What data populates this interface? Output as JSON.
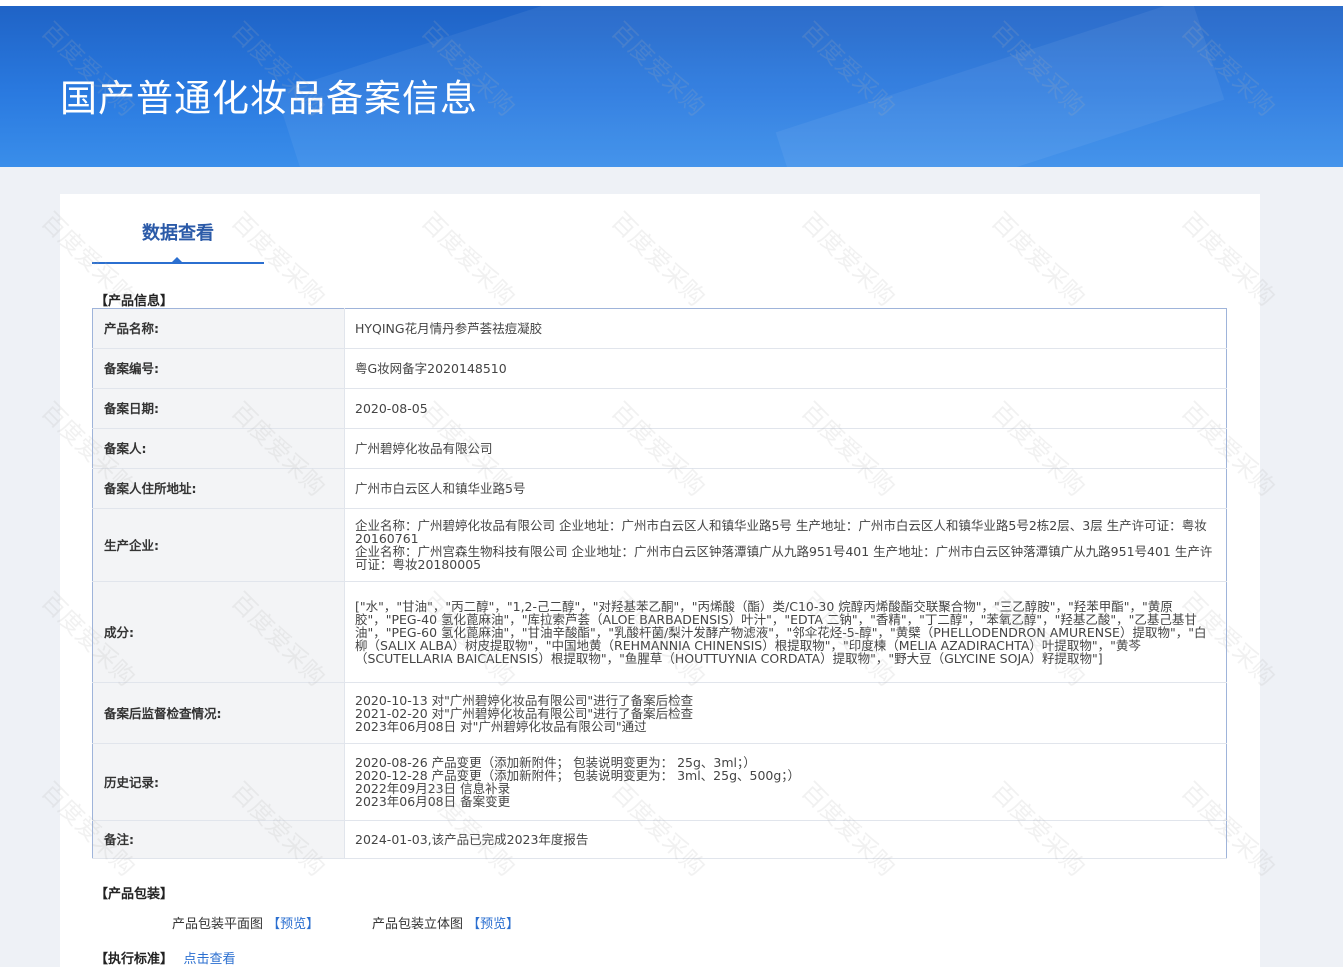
{
  "page": {
    "title": "国产普通化妆品备案信息"
  },
  "tab": {
    "label": "数据查看"
  },
  "product_info": {
    "section_title": "【产品信息】",
    "rows": [
      {
        "key": "产品名称:",
        "value": [
          "HYQING花月情丹参芦荟祛痘凝胶"
        ]
      },
      {
        "key": "备案编号:",
        "value": [
          "粤G妆网备字2020148510"
        ]
      },
      {
        "key": "备案日期:",
        "value": [
          "2020-08-05"
        ]
      },
      {
        "key": "备案人:",
        "value": [
          "广州碧婷化妆品有限公司"
        ]
      },
      {
        "key": "备案人住所地址:",
        "value": [
          "广州市白云区人和镇华业路5号"
        ]
      },
      {
        "key": "生产企业:",
        "value": [
          "企业名称：广州碧婷化妆品有限公司 企业地址：广州市白云区人和镇华业路5号 生产地址：广州市白云区人和镇华业路5号2栋2层、3层 生产许可证：粤妆20160761",
          "企业名称：广州宫森生物科技有限公司 企业地址：广州市白云区钟落潭镇广从九路951号401 生产地址：广州市白云区钟落潭镇广从九路951号401 生产许可证：粤妆20180005"
        ]
      },
      {
        "key": "成分:",
        "value": [
          "[\"水\"，\"甘油\"，\"丙二醇\"，\"1,2-己二醇\"，\"对羟基苯乙酮\"，\"丙烯酸（酯）类/C10-30 烷醇丙烯酸酯交联聚合物\"，\"三乙醇胺\"，\"羟苯甲酯\"，\"黄原胶\"，\"PEG-40 氢化蓖麻油\"，\"库拉索芦荟（ALOE BARBADENSIS）叶汁\"，\"EDTA 二钠\"，\"香精\"，\"丁二醇\"，\"苯氧乙醇\"，\"羟基乙酸\"，\"乙基己基甘油\"，\"PEG-60 氢化蓖麻油\"，\"甘油辛酸酯\"，\"乳酸杆菌/梨汁发酵产物滤液\"，\"邻伞花烃-5-醇\"，\"黄檗（PHELLODENDRON AMURENSE）提取物\"，\"白柳（SALIX ALBA）树皮提取物\"，\"中国地黄（REHMANNIA CHINENSIS）根提取物\"，\"印度楝（MELIA AZADIRACHTA）叶提取物\"，\"黄芩（SCUTELLARIA BAICALENSIS）根提取物\"，\"鱼腥草（HOUTTUYNIA CORDATA）提取物\"，\"野大豆（GLYCINE SOJA）籽提取物\"]"
        ]
      },
      {
        "key": "备案后监督检查情况:",
        "value": [
          "2020-10-13 对\"广州碧婷化妆品有限公司\"进行了备案后检查",
          "2021-02-20 对\"广州碧婷化妆品有限公司\"进行了备案后检查",
          "2023年06月08日 对\"广州碧婷化妆品有限公司\"通过"
        ]
      },
      {
        "key": "历史记录:",
        "value": [
          "2020-08-26 产品变更（添加新附件； 包装说明变更为： 25g、3ml；）",
          "2020-12-28 产品变更（添加新附件； 包装说明变更为： 3ml、25g、500g；）",
          "2022年09月23日 信息补录",
          "2023年06月08日 备案变更"
        ]
      },
      {
        "key": "备注:",
        "value": [
          "2024-01-03,该产品已完成2023年度报告"
        ]
      }
    ]
  },
  "packaging": {
    "section_title": "【产品包装】",
    "flat_label": "产品包装平面图",
    "flat_link": "【预览】",
    "solid_label": "产品包装立体图",
    "solid_link": "【预览】"
  },
  "standard": {
    "section_title": "【执行标准】",
    "link": "点击查看"
  },
  "watermark": {
    "text": "百度爱采购"
  }
}
